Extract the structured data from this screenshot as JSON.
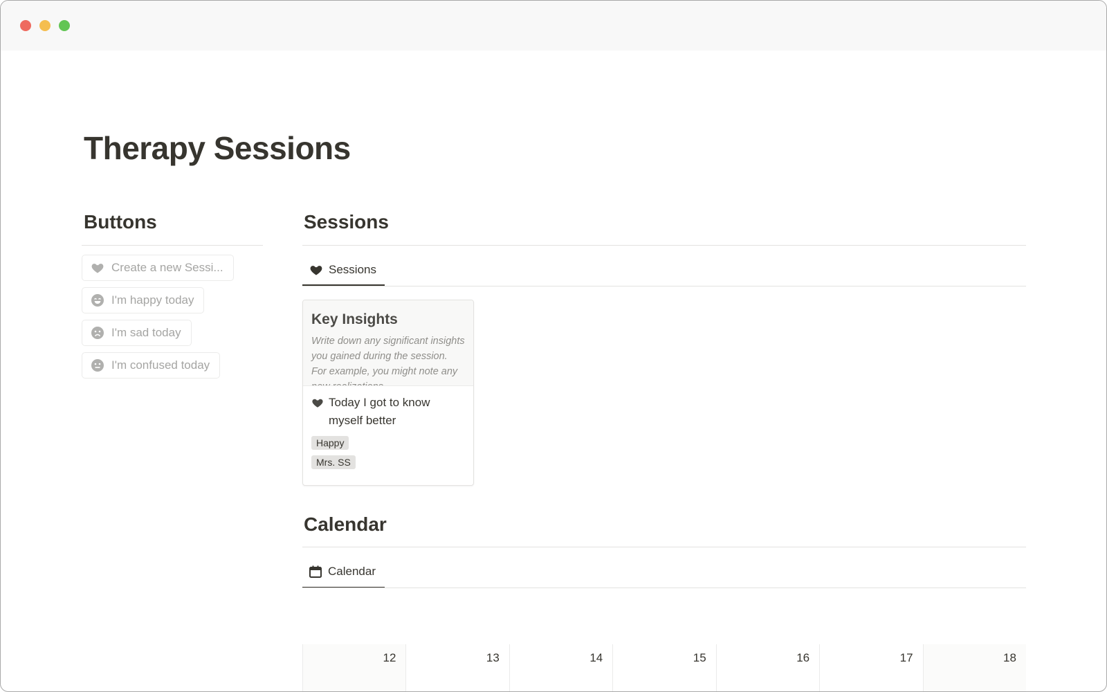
{
  "window": {
    "controls": [
      "close",
      "minimize",
      "maximize"
    ]
  },
  "page": {
    "title": "Therapy Sessions"
  },
  "buttons_section": {
    "heading": "Buttons",
    "items": [
      {
        "label": "Create a new Sessi...",
        "icon": "heart-icon"
      },
      {
        "label": "I'm happy today",
        "icon": "smile-face-icon"
      },
      {
        "label": "I'm sad today",
        "icon": "sad-face-icon"
      },
      {
        "label": "I'm confused today",
        "icon": "neutral-face-icon"
      }
    ]
  },
  "sessions_section": {
    "heading": "Sessions",
    "view_tab": {
      "label": "Sessions",
      "icon": "heart-icon"
    },
    "cards": [
      {
        "cover_title": "Key Insights",
        "cover_text": "Write down any significant insights you gained during the session. For example, you might note any new realizations",
        "title": "Today I got to know myself better",
        "icon": "heart-icon",
        "tags": [
          "Happy",
          "Mrs. SS"
        ]
      }
    ]
  },
  "calendar_section": {
    "heading": "Calendar",
    "view_tab": {
      "label": "Calendar",
      "icon": "calendar-icon"
    },
    "days": [
      "12",
      "13",
      "14",
      "15",
      "16",
      "17",
      "18"
    ]
  },
  "colors": {
    "text": "#37352f",
    "muted_text": "#a5a5a3",
    "tag_bg": "#e3e2e0",
    "divider": "#e3e2e0",
    "traffic_red": "#ee6a5f",
    "traffic_yellow": "#f5be4f",
    "traffic_green": "#62c554"
  }
}
